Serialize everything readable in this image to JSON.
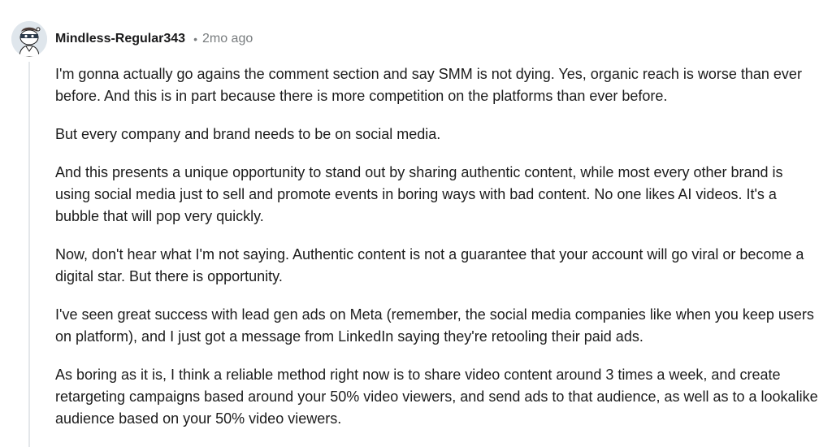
{
  "comment": {
    "author": "Mindless-Regular343",
    "separator": "•",
    "age": "2mo ago",
    "paragraphs": [
      "I'm gonna actually go agains the comment section and say SMM is not dying. Yes, organic reach is worse than ever before. And this is in part because there is more competition on the platforms than ever before.",
      "But every company and brand needs to be on social media.",
      "And this presents a unique opportunity to stand out by sharing authentic content, while most every other brand is using social media just to sell and promote events in boring ways with bad content. No one likes AI videos. It's a bubble that will pop very quickly.",
      "Now, don't hear what I'm not saying. Authentic content is not a guarantee that your account will go viral or become a digital star. But there is opportunity.",
      "I've seen great success with lead gen ads on Meta (remember, the social media companies like when you keep users on platform), and I just got a message from LinkedIn saying they're retooling their paid ads.",
      "As boring as it is, I think a reliable method right now is to share video content around 3 times a week, and create retargeting campaigns based around your 50% video viewers, and send ads to that audience, as well as to a lookalike audience based on your 50% video viewers."
    ]
  },
  "colors": {
    "author": "#1a1a1b",
    "meta_gray": "#787c7e",
    "body_text": "#1c1c1c",
    "thread_line": "#e4e7ea",
    "avatar_bg": "#dfe6ec"
  },
  "icons": {
    "avatar": "snoo-avatar-icon"
  }
}
